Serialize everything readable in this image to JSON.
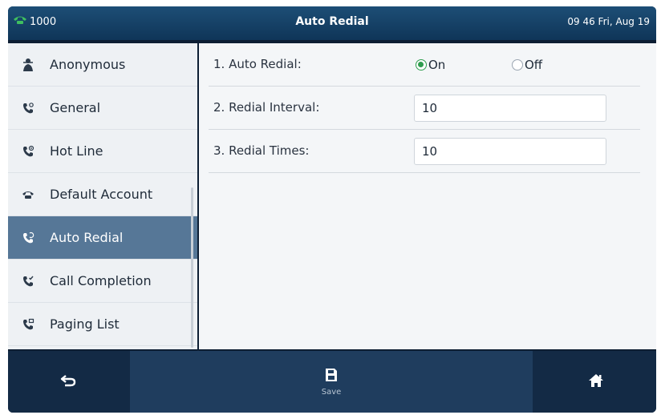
{
  "topbar": {
    "account": "1000",
    "title": "Auto Redial",
    "clock": "09 46 Fri, Aug 19"
  },
  "sidebar": {
    "items": [
      {
        "label": "Anonymous",
        "icon": "anonymous-icon"
      },
      {
        "label": "General",
        "icon": "phone-gear-icon"
      },
      {
        "label": "Hot Line",
        "icon": "phone-hotline-icon"
      },
      {
        "label": "Default Account",
        "icon": "telephone-icon"
      },
      {
        "label": "Auto Redial",
        "icon": "phone-redial-icon",
        "active": true
      },
      {
        "label": "Call Completion",
        "icon": "phone-completion-icon"
      },
      {
        "label": "Paging List",
        "icon": "phone-paging-icon"
      }
    ]
  },
  "main": {
    "auto_redial": {
      "label": "1. Auto Redial:",
      "on_label": "On",
      "off_label": "Off",
      "selected": "On"
    },
    "redial_interval": {
      "label": "2. Redial Interval:",
      "value": "10"
    },
    "redial_times": {
      "label": "3. Redial Times:",
      "value": "10"
    }
  },
  "bottombar": {
    "save_label": "Save"
  },
  "colors": {
    "topbar": "#1d4e76",
    "active_item": "#567797",
    "radio_selected": "#2e9d4e",
    "bottombar": "#132a45",
    "account_icon": "#3fbf5f"
  }
}
